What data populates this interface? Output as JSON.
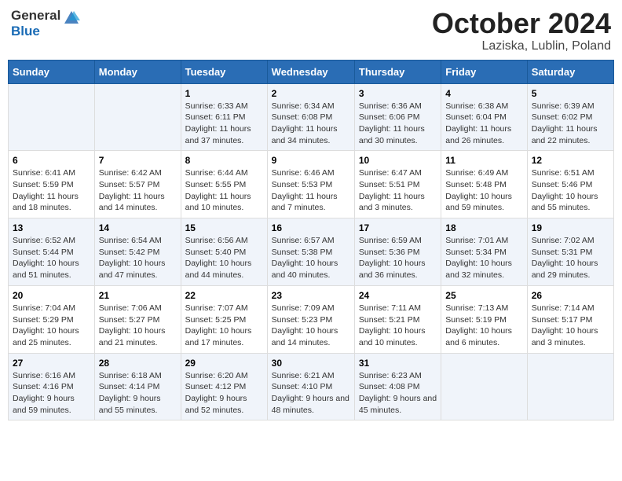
{
  "header": {
    "logo_general": "General",
    "logo_blue": "Blue",
    "month_title": "October 2024",
    "location": "Laziska, Lublin, Poland"
  },
  "weekdays": [
    "Sunday",
    "Monday",
    "Tuesday",
    "Wednesday",
    "Thursday",
    "Friday",
    "Saturday"
  ],
  "weeks": [
    [
      {
        "day": "",
        "info": ""
      },
      {
        "day": "",
        "info": ""
      },
      {
        "day": "1",
        "info": "Sunrise: 6:33 AM\nSunset: 6:11 PM\nDaylight: 11 hours and 37 minutes."
      },
      {
        "day": "2",
        "info": "Sunrise: 6:34 AM\nSunset: 6:08 PM\nDaylight: 11 hours and 34 minutes."
      },
      {
        "day": "3",
        "info": "Sunrise: 6:36 AM\nSunset: 6:06 PM\nDaylight: 11 hours and 30 minutes."
      },
      {
        "day": "4",
        "info": "Sunrise: 6:38 AM\nSunset: 6:04 PM\nDaylight: 11 hours and 26 minutes."
      },
      {
        "day": "5",
        "info": "Sunrise: 6:39 AM\nSunset: 6:02 PM\nDaylight: 11 hours and 22 minutes."
      }
    ],
    [
      {
        "day": "6",
        "info": "Sunrise: 6:41 AM\nSunset: 5:59 PM\nDaylight: 11 hours and 18 minutes."
      },
      {
        "day": "7",
        "info": "Sunrise: 6:42 AM\nSunset: 5:57 PM\nDaylight: 11 hours and 14 minutes."
      },
      {
        "day": "8",
        "info": "Sunrise: 6:44 AM\nSunset: 5:55 PM\nDaylight: 11 hours and 10 minutes."
      },
      {
        "day": "9",
        "info": "Sunrise: 6:46 AM\nSunset: 5:53 PM\nDaylight: 11 hours and 7 minutes."
      },
      {
        "day": "10",
        "info": "Sunrise: 6:47 AM\nSunset: 5:51 PM\nDaylight: 11 hours and 3 minutes."
      },
      {
        "day": "11",
        "info": "Sunrise: 6:49 AM\nSunset: 5:48 PM\nDaylight: 10 hours and 59 minutes."
      },
      {
        "day": "12",
        "info": "Sunrise: 6:51 AM\nSunset: 5:46 PM\nDaylight: 10 hours and 55 minutes."
      }
    ],
    [
      {
        "day": "13",
        "info": "Sunrise: 6:52 AM\nSunset: 5:44 PM\nDaylight: 10 hours and 51 minutes."
      },
      {
        "day": "14",
        "info": "Sunrise: 6:54 AM\nSunset: 5:42 PM\nDaylight: 10 hours and 47 minutes."
      },
      {
        "day": "15",
        "info": "Sunrise: 6:56 AM\nSunset: 5:40 PM\nDaylight: 10 hours and 44 minutes."
      },
      {
        "day": "16",
        "info": "Sunrise: 6:57 AM\nSunset: 5:38 PM\nDaylight: 10 hours and 40 minutes."
      },
      {
        "day": "17",
        "info": "Sunrise: 6:59 AM\nSunset: 5:36 PM\nDaylight: 10 hours and 36 minutes."
      },
      {
        "day": "18",
        "info": "Sunrise: 7:01 AM\nSunset: 5:34 PM\nDaylight: 10 hours and 32 minutes."
      },
      {
        "day": "19",
        "info": "Sunrise: 7:02 AM\nSunset: 5:31 PM\nDaylight: 10 hours and 29 minutes."
      }
    ],
    [
      {
        "day": "20",
        "info": "Sunrise: 7:04 AM\nSunset: 5:29 PM\nDaylight: 10 hours and 25 minutes."
      },
      {
        "day": "21",
        "info": "Sunrise: 7:06 AM\nSunset: 5:27 PM\nDaylight: 10 hours and 21 minutes."
      },
      {
        "day": "22",
        "info": "Sunrise: 7:07 AM\nSunset: 5:25 PM\nDaylight: 10 hours and 17 minutes."
      },
      {
        "day": "23",
        "info": "Sunrise: 7:09 AM\nSunset: 5:23 PM\nDaylight: 10 hours and 14 minutes."
      },
      {
        "day": "24",
        "info": "Sunrise: 7:11 AM\nSunset: 5:21 PM\nDaylight: 10 hours and 10 minutes."
      },
      {
        "day": "25",
        "info": "Sunrise: 7:13 AM\nSunset: 5:19 PM\nDaylight: 10 hours and 6 minutes."
      },
      {
        "day": "26",
        "info": "Sunrise: 7:14 AM\nSunset: 5:17 PM\nDaylight: 10 hours and 3 minutes."
      }
    ],
    [
      {
        "day": "27",
        "info": "Sunrise: 6:16 AM\nSunset: 4:16 PM\nDaylight: 9 hours and 59 minutes."
      },
      {
        "day": "28",
        "info": "Sunrise: 6:18 AM\nSunset: 4:14 PM\nDaylight: 9 hours and 55 minutes."
      },
      {
        "day": "29",
        "info": "Sunrise: 6:20 AM\nSunset: 4:12 PM\nDaylight: 9 hours and 52 minutes."
      },
      {
        "day": "30",
        "info": "Sunrise: 6:21 AM\nSunset: 4:10 PM\nDaylight: 9 hours and 48 minutes."
      },
      {
        "day": "31",
        "info": "Sunrise: 6:23 AM\nSunset: 4:08 PM\nDaylight: 9 hours and 45 minutes."
      },
      {
        "day": "",
        "info": ""
      },
      {
        "day": "",
        "info": ""
      }
    ]
  ]
}
